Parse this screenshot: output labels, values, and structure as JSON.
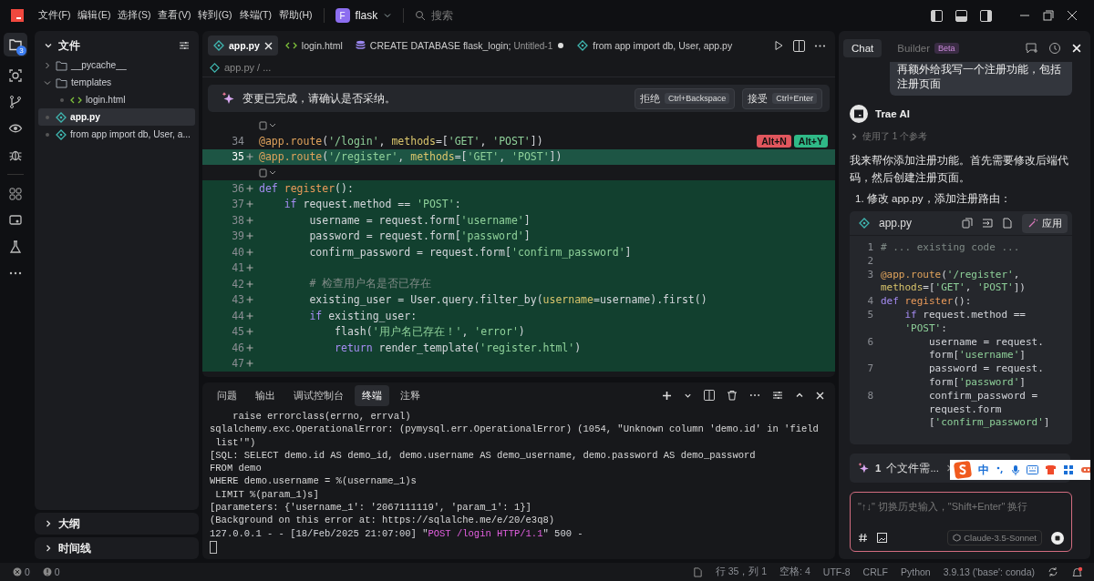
{
  "menu": [
    "文件(F)",
    "编辑(E)",
    "选择(S)",
    "查看(V)",
    "转到(G)",
    "终端(T)",
    "帮助(H)"
  ],
  "project": {
    "initial": "F",
    "name": "flask"
  },
  "search": {
    "placeholder": "搜索"
  },
  "activity": {
    "badge": "3"
  },
  "sidebar": {
    "title": "文件",
    "items": [
      {
        "name": "__pycache__",
        "kind": "folder",
        "expanded": false,
        "selected": false
      },
      {
        "name": "templates",
        "kind": "folder",
        "expanded": true,
        "selected": false,
        "children": [
          {
            "name": "login.html",
            "kind": "html",
            "selected": false
          }
        ]
      },
      {
        "name": "app.py",
        "kind": "py",
        "selected": true
      },
      {
        "name": "from app import db, User, a...",
        "kind": "py",
        "selected": false
      }
    ],
    "sections": [
      "大纲",
      "时间线"
    ]
  },
  "tabs": [
    {
      "label": "app.py",
      "kind": "py",
      "selected": true
    },
    {
      "label": "login.html",
      "kind": "html",
      "selected": false
    },
    {
      "label": "CREATE DATABASE flask_login;",
      "detail": "Untitled-1",
      "kind": "db",
      "selected": false,
      "modified": true
    },
    {
      "label": "from app import db, User, app.py",
      "kind": "py",
      "selected": false
    }
  ],
  "breadcrumb": "app.py / ...",
  "banner": {
    "text": "变更已完成，请确认是否采纳。",
    "buttons": [
      {
        "label": "拒绝",
        "shortcut": "Ctrl+Backspace"
      },
      {
        "label": "接受",
        "shortcut": "Ctrl+Enter"
      }
    ]
  },
  "diff_actions": [
    {
      "label": "Alt+N",
      "kind": "reject"
    },
    {
      "label": "Alt+Y",
      "kind": "accept"
    }
  ],
  "code": [
    {
      "num": "34",
      "added": false,
      "current": false,
      "widget_above": true,
      "actions": true,
      "tokens": [
        {
          "kind": "dec",
          "t": "@app.route"
        },
        {
          "kind": "p",
          "t": "("
        },
        {
          "kind": "str",
          "t": "'/login'"
        },
        {
          "kind": "p",
          "t": ", "
        },
        {
          "kind": "arg",
          "t": "methods"
        },
        {
          "kind": "p",
          "t": "=["
        },
        {
          "kind": "str",
          "t": "'GET'"
        },
        {
          "kind": "p",
          "t": ", "
        },
        {
          "kind": "str",
          "t": "'POST'"
        },
        {
          "kind": "p",
          "t": "])"
        }
      ]
    },
    {
      "num": "35",
      "added": true,
      "current": true,
      "widget_above": false,
      "actions": false,
      "tokens": [
        {
          "kind": "dec",
          "t": "@app.route"
        },
        {
          "kind": "p",
          "t": "("
        },
        {
          "kind": "str",
          "t": "'/register'"
        },
        {
          "kind": "p",
          "t": ", "
        },
        {
          "kind": "arg",
          "t": "methods"
        },
        {
          "kind": "p",
          "t": "=["
        },
        {
          "kind": "str",
          "t": "'GET'"
        },
        {
          "kind": "p",
          "t": ", "
        },
        {
          "kind": "str",
          "t": "'POST'"
        },
        {
          "kind": "p",
          "t": "])"
        }
      ]
    },
    {
      "num": "36",
      "added": true,
      "current": false,
      "widget_above": true,
      "actions": false,
      "tokens": [
        {
          "kind": "kw",
          "t": "def "
        },
        {
          "kind": "fn",
          "t": "register"
        },
        {
          "kind": "p",
          "t": "():"
        }
      ]
    },
    {
      "num": "37",
      "added": true,
      "current": false,
      "widget_above": false,
      "actions": false,
      "tokens": [
        {
          "kind": "kw",
          "t": "    if "
        },
        {
          "kind": "p",
          "t": "request.method == "
        },
        {
          "kind": "str",
          "t": "'POST'"
        },
        {
          "kind": "p",
          "t": ":"
        }
      ]
    },
    {
      "num": "38",
      "added": true,
      "current": false,
      "widget_above": false,
      "actions": false,
      "tokens": [
        {
          "kind": "p",
          "t": "        username = request.form["
        },
        {
          "kind": "str",
          "t": "'username'"
        },
        {
          "kind": "p",
          "t": "]"
        }
      ]
    },
    {
      "num": "39",
      "added": true,
      "current": false,
      "widget_above": false,
      "actions": false,
      "tokens": [
        {
          "kind": "p",
          "t": "        password = request.form["
        },
        {
          "kind": "str",
          "t": "'password'"
        },
        {
          "kind": "p",
          "t": "]"
        }
      ]
    },
    {
      "num": "40",
      "added": true,
      "current": false,
      "widget_above": false,
      "actions": false,
      "tokens": [
        {
          "kind": "p",
          "t": "        confirm_password = request.form["
        },
        {
          "kind": "str",
          "t": "'confirm_password'"
        },
        {
          "kind": "p",
          "t": "]"
        }
      ]
    },
    {
      "num": "41",
      "added": true,
      "current": false,
      "widget_above": false,
      "actions": false
    },
    {
      "num": "42",
      "added": true,
      "current": false,
      "widget_above": false,
      "actions": false,
      "tokens": [
        {
          "kind": "cm",
          "t": "        # 检查用户名是否已存在"
        }
      ]
    },
    {
      "num": "43",
      "added": true,
      "current": false,
      "widget_above": false,
      "actions": false,
      "tokens": [
        {
          "kind": "p",
          "t": "        existing_user = User.query.filter_by("
        },
        {
          "kind": "arg",
          "t": "username"
        },
        {
          "kind": "p",
          "t": "=username).first()"
        }
      ]
    },
    {
      "num": "44",
      "added": true,
      "current": false,
      "widget_above": false,
      "actions": false,
      "tokens": [
        {
          "kind": "kw",
          "t": "        if "
        },
        {
          "kind": "p",
          "t": "existing_user:"
        }
      ]
    },
    {
      "num": "45",
      "added": true,
      "current": false,
      "widget_above": false,
      "actions": false,
      "tokens": [
        {
          "kind": "p",
          "t": "            flash("
        },
        {
          "kind": "str",
          "t": "'用户名已存在！'"
        },
        {
          "kind": "p",
          "t": ", "
        },
        {
          "kind": "str",
          "t": "'error'"
        },
        {
          "kind": "p",
          "t": ")"
        }
      ]
    },
    {
      "num": "46",
      "added": true,
      "current": false,
      "widget_above": false,
      "actions": false,
      "tokens": [
        {
          "kind": "kw",
          "t": "            return "
        },
        {
          "kind": "p",
          "t": "render_template("
        },
        {
          "kind": "str",
          "t": "'register.html'"
        },
        {
          "kind": "p",
          "t": ")"
        }
      ]
    },
    {
      "num": "47",
      "added": true,
      "current": false,
      "widget_above": false,
      "actions": false
    }
  ],
  "panel_tabs": [
    {
      "label": "问题",
      "selected": false
    },
    {
      "label": "输出",
      "selected": false
    },
    {
      "label": "调试控制台",
      "selected": false
    },
    {
      "label": "终端",
      "selected": true
    },
    {
      "label": "注释",
      "selected": false
    }
  ],
  "terminal": [
    "    raise errorclass(errno, errval)",
    "sqlalchemy.exc.OperationalError: (pymysql.err.OperationalError) (1054, \"Unknown column 'demo.id' in 'field",
    " list'\")",
    "[SQL: SELECT demo.id AS demo_id, demo.username AS demo_username, demo.password AS demo_password",
    "FROM demo",
    "WHERE demo.username = %(username_1)s",
    " LIMIT %(param_1)s]",
    "[parameters: {'username_1': '2067111119', 'param_1': 1}]",
    "(Background on this error at: https://sqlalche.me/e/20/e3q8)",
    [
      {
        "kind": "p",
        "t": "127.0.0.1 - - [18/Feb/2025 21:07:00] \""
      },
      {
        "kind": "req",
        "t": "POST /login HTTP/1.1"
      },
      {
        "kind": "p",
        "t": "\" 500 -"
      }
    ]
  ],
  "chat": {
    "tabs": [
      {
        "label": "Chat",
        "selected": true
      },
      {
        "label": "Builder",
        "badge": "Beta",
        "selected": false
      }
    ],
    "user_message": "再额外给我写一个注册功能，包括注册页面",
    "assistant": "Trae AI",
    "reference": "使用了 1 个参考",
    "paragraph": "我来帮你添加注册功能。首先需要修改后端代码，然后创建注册页面。",
    "step": "1. 修改 app.py，添加注册路由：",
    "code_file": "app.py",
    "apply": "应用",
    "code_rows": [
      {
        "num": "1",
        "tokens": [
          {
            "kind": "cm",
            "t": "# ... existing code ..."
          }
        ]
      },
      {
        "num": "2"
      },
      {
        "num": "3",
        "tokens": [
          {
            "kind": "dec",
            "t": "@app.route"
          },
          {
            "kind": "p",
            "t": "("
          },
          {
            "kind": "str",
            "t": "'/register'"
          },
          {
            "kind": "p",
            "t": ","
          }
        ]
      },
      {
        "tokens": [
          {
            "kind": "arg",
            "t": "methods"
          },
          {
            "kind": "p",
            "t": "=["
          },
          {
            "kind": "str",
            "t": "'GET'"
          },
          {
            "kind": "p",
            "t": ", "
          },
          {
            "kind": "str",
            "t": "'POST'"
          },
          {
            "kind": "p",
            "t": "])"
          }
        ]
      },
      {
        "num": "4",
        "tokens": [
          {
            "kind": "kw",
            "t": "def "
          },
          {
            "kind": "fn",
            "t": "register"
          },
          {
            "kind": "p",
            "t": "():"
          }
        ]
      },
      {
        "num": "5",
        "tokens": [
          {
            "kind": "kw",
            "t": "    if "
          },
          {
            "kind": "p",
            "t": "request.method =="
          }
        ]
      },
      {
        "tokens": [
          {
            "kind": "str",
            "t": "    'POST'"
          },
          {
            "kind": "p",
            "t": ":"
          }
        ]
      },
      {
        "num": "6",
        "tokens": [
          {
            "kind": "p",
            "t": "        username = request."
          }
        ]
      },
      {
        "tokens": [
          {
            "kind": "p",
            "t": "        form["
          },
          {
            "kind": "str",
            "t": "'username'"
          },
          {
            "kind": "p",
            "t": "]"
          }
        ]
      },
      {
        "num": "7",
        "tokens": [
          {
            "kind": "p",
            "t": "        password = request."
          }
        ]
      },
      {
        "tokens": [
          {
            "kind": "p",
            "t": "        form["
          },
          {
            "kind": "str",
            "t": "'password'"
          },
          {
            "kind": "p",
            "t": "]"
          }
        ]
      },
      {
        "num": "8",
        "tokens": [
          {
            "kind": "p",
            "t": "        confirm_password ="
          }
        ]
      },
      {
        "tokens": [
          {
            "kind": "p",
            "t": "        request.form"
          }
        ]
      },
      {
        "tokens": [
          {
            "kind": "p",
            "t": "        ["
          },
          {
            "kind": "str",
            "t": "'confirm_password'"
          },
          {
            "kind": "p",
            "t": "]"
          }
        ]
      }
    ],
    "pending_count": "1",
    "pending": "个文件需...",
    "ime": "中",
    "input": {
      "placeholder": "\"↑↓\" 切换历史输入，\"Shift+Enter\" 换行"
    },
    "model": "Claude-3.5-Sonnet"
  },
  "status": {
    "errors": "0",
    "warnings": "0",
    "items": [
      "行 35，列 1",
      "空格: 4",
      "UTF-8",
      "CRLF",
      "Python",
      "3.9.13 ('base': conda)"
    ]
  }
}
